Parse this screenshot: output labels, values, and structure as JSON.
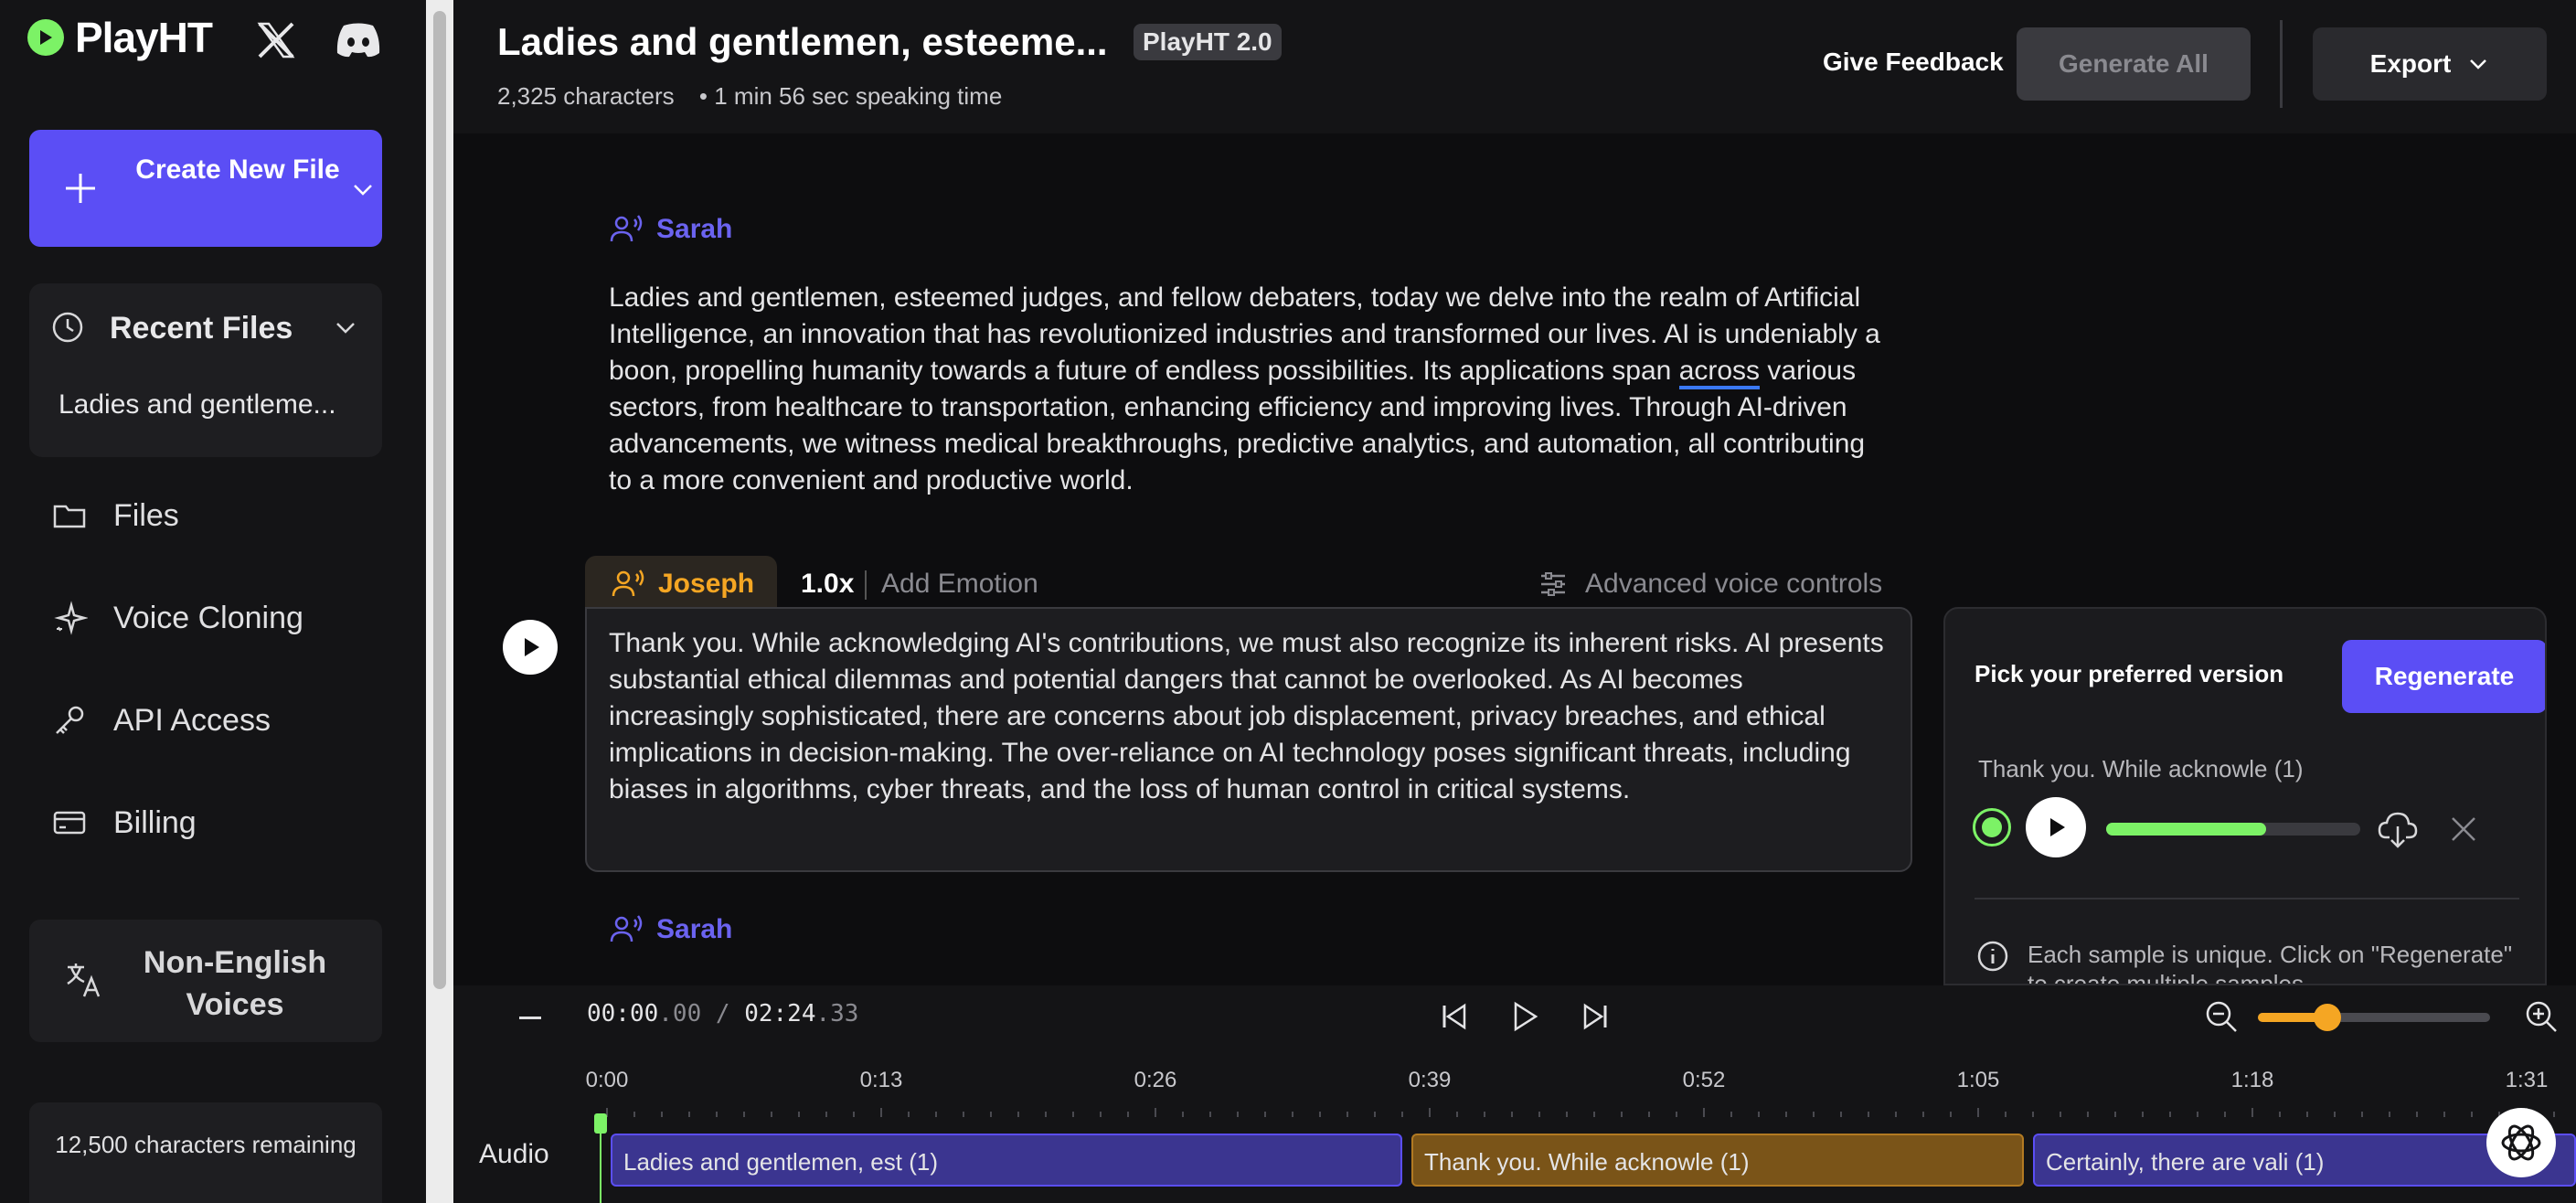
{
  "sidebar": {
    "brand": "PlayHT",
    "create_button": "Create New File",
    "recent": {
      "title": "Recent Files",
      "files": [
        "Ladies and gentleme..."
      ]
    },
    "nav": [
      {
        "label": "Files",
        "icon": "folder-icon"
      },
      {
        "label": "Voice Cloning",
        "icon": "sparkle-icon"
      },
      {
        "label": "API Access",
        "icon": "key-icon"
      },
      {
        "label": "Billing",
        "icon": "credit-card-icon"
      }
    ],
    "non_english": "Non-English Voices",
    "chars_remaining": "12,500 characters remaining"
  },
  "header": {
    "title": "Ladies and gentlemen, esteeme...",
    "badge": "PlayHT 2.0",
    "characters": "2,325 characters",
    "speaking_time": "• 1 min 56 sec speaking time",
    "feedback": "Give Feedback",
    "generate_all": "Generate All",
    "export": "Export"
  },
  "blocks": [
    {
      "speaker": "Sarah",
      "text_before": "Ladies and gentlemen, esteemed judges, and fellow debaters, today we delve into the realm of Artificial Intelligence, an innovation that has revolutionized industries and transformed our lives. AI is undeniably a boon, propelling humanity towards a future of endless possibilities. Its applications span ",
      "text_underlined": "across",
      "text_after": " various sectors, from healthcare to transportation, enhancing efficiency and improving lives. Through AI-driven advancements, we witness medical breakthroughs, predictive analytics, and automation, all contributing to a more convenient and productive world."
    },
    {
      "speaker": "Joseph",
      "speed": "1.0x",
      "add_emotion": "Add Emotion",
      "advanced": "Advanced voice controls",
      "text": "Thank you. While acknowledging AI's contributions, we must also recognize its inherent risks. AI presents substantial ethical dilemmas and potential dangers that cannot be overlooked. As AI becomes increasingly sophisticated, there are concerns about job displacement, privacy breaches, and ethical implications in decision-making. The over-reliance on AI technology poses significant threats, including biases in algorithms, cyber threats, and the loss of human control in critical systems."
    },
    {
      "speaker": "Sarah"
    }
  ],
  "version_panel": {
    "pick_label": "Pick your preferred version",
    "regenerate": "Regenerate",
    "sample_name": "Thank you. While acknowle (1)",
    "sample_progress": 0.63,
    "info": "Each sample is unique. Click on \"Regenerate\" to create multiple samples"
  },
  "timeline": {
    "current": "00:00",
    "current_ms": ".00",
    "total": "02:24",
    "total_ms": ".33",
    "zoom_level": 0.3,
    "ticks": [
      "0:00",
      "0:13",
      "0:26",
      "0:39",
      "0:52",
      "1:05",
      "1:18",
      "1:31"
    ],
    "track_label": "Audio",
    "clips": [
      {
        "label": "Ladies and gentlemen, est (1)",
        "color": "blue"
      },
      {
        "label": "Thank you. While acknowle (1)",
        "color": "orange"
      },
      {
        "label": "Certainly, there are vali (1)",
        "color": "blue"
      }
    ]
  },
  "colors": {
    "accent": "#5b4ef5",
    "joseph": "#f5a623",
    "sarah": "#6b63f0",
    "progress": "#7cf266"
  }
}
